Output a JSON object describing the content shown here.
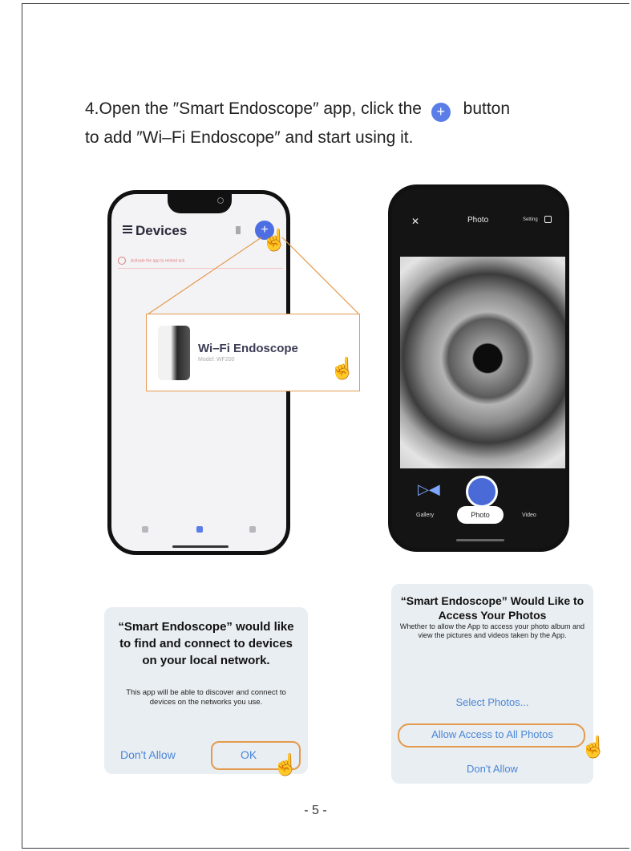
{
  "instruction": {
    "line1_before": "4.Open the ″Smart Endoscope″ app, click the",
    "line1_after": "button",
    "line2": "to add ″Wi–Fi Endoscope″ and start using it.",
    "plus_symbol": "+"
  },
  "phone_devices": {
    "title": "Devices",
    "add_symbol": "+",
    "banner_text": "Activate the app to remind ack"
  },
  "callout": {
    "device_name": "Wi–Fi Endoscope",
    "device_model": "Model: WF200"
  },
  "phone_camera": {
    "close_symbol": "✕",
    "title": "Photo",
    "setting": "Setting",
    "flip_symbol": "▷◀",
    "tabs": {
      "gallery": "Gallery",
      "photo": "Photo",
      "video": "Video"
    }
  },
  "dialog_network": {
    "title": "“Smart Endoscope” would like to find and connect to devices on your local network.",
    "message": "This app will be able to discover and connect to devices on the networks you use.",
    "dont_allow": "Don't Allow",
    "ok": "OK"
  },
  "dialog_photos": {
    "title": "“Smart Endoscope” Would Like to Access Your Photos",
    "message": "Whether to allow the App to access your photo album and view the pictures and videos taken by the App.",
    "select_photos": "Select Photos...",
    "allow_all": "Allow Access to All Photos",
    "dont_allow": "Don't Allow"
  },
  "page_number": "- 5 -",
  "hand_symbol": "☝",
  "colors": {
    "accent": "#e49a4e",
    "link_blue": "#4a86d8",
    "plus_blue": "#5b7de8"
  }
}
